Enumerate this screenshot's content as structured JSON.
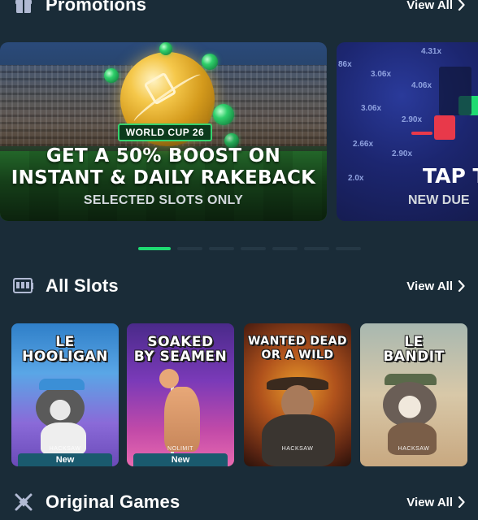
{
  "promotions": {
    "title": "Promotions",
    "icon": "gift-icon",
    "view_all": "View All"
  },
  "banners": [
    {
      "badge": "WORLD CUP 26",
      "headline_line1": "GET A 50% BOOST ON",
      "headline_line2": "INSTANT & DAILY RAKEBACK",
      "subtext": "SELECTED SLOTS ONLY"
    },
    {
      "headline": "TAP T",
      "subtext": "NEW DUE",
      "multipliers": [
        "4.31x",
        "86x",
        "3.06x",
        "4.06x",
        "3.06x",
        "2.90x",
        "2.66x",
        "2.90x",
        "2.0x"
      ]
    }
  ],
  "pagination": {
    "count": 7,
    "active_index": 0
  },
  "all_slots": {
    "title": "All Slots",
    "icon": "slot-machine-icon",
    "view_all": "View All",
    "games": [
      {
        "title": "LE\nHOOLIGAN",
        "provider": "HACKSAW",
        "badge": "New"
      },
      {
        "title": "SOAKED\nBY SEAMEN",
        "provider": "NOLIMIT",
        "badge": "New"
      },
      {
        "title": "WANTED DEAD\nOR A WILD",
        "provider": "HACKSAW",
        "badge": ""
      },
      {
        "title": "LE\nBANDIT",
        "provider": "HACKSAW",
        "badge": ""
      }
    ]
  },
  "original_games": {
    "title": "Original Games",
    "icon": "crossed-swords-icon",
    "view_all": "View All"
  },
  "colors": {
    "background": "#1a2c38",
    "accent_green": "#1fdb72",
    "dot_inactive": "#253845",
    "new_badge": "#1a5a6e"
  }
}
